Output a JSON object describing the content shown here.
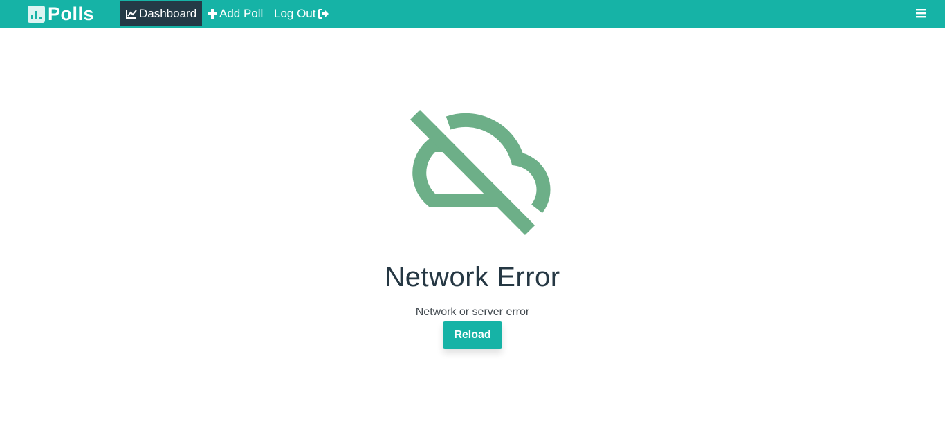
{
  "colors": {
    "navbar": "#16b3a6",
    "active_nav": "#243a46",
    "icon_green": "#6daf88",
    "title_text": "#253743",
    "button": "#16b3a6"
  },
  "brand": {
    "name": "Polls",
    "icon": "bar-chart-icon"
  },
  "nav": {
    "items": [
      {
        "label": "Dashboard",
        "icon": "line-chart-icon",
        "active": true
      },
      {
        "label": "Add Poll",
        "icon": "plus-icon",
        "active": false
      },
      {
        "label": "Log Out",
        "icon": "sign-out-icon",
        "active": false
      }
    ],
    "menu_icon": "hamburger-icon"
  },
  "error": {
    "icon": "cloud-off-icon",
    "title": "Network Error",
    "message": "Network or server error",
    "button_label": "Reload"
  }
}
